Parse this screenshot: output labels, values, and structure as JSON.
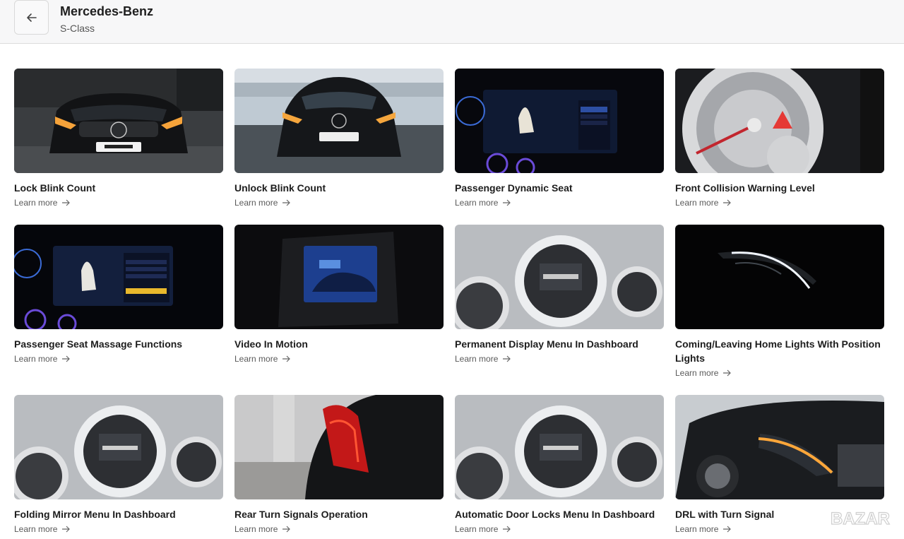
{
  "header": {
    "make": "Mercedes-Benz",
    "model": "S-Class",
    "back_icon": "arrow-left-icon"
  },
  "cards": [
    {
      "title": "Lock  Blink  Count",
      "link": "Learn more",
      "image": "car-front-night"
    },
    {
      "title": "Unlock  Blink  Count",
      "link": "Learn more",
      "image": "car-front-lake"
    },
    {
      "title": "Passenger Dynamic  Seat",
      "link": "Learn more",
      "image": "infotainment-seat"
    },
    {
      "title": "Front Collision Warning Level",
      "link": "Learn more",
      "image": "speedometer"
    },
    {
      "title": "Passenger Seat Massage Functions",
      "link": "Learn more",
      "image": "infotainment-massage"
    },
    {
      "title": "Video In Motion",
      "link": "Learn more",
      "image": "screen-video"
    },
    {
      "title": "Permanent Display Menu In Dashboard",
      "link": "Learn more",
      "image": "instrument-cluster"
    },
    {
      "title": "Coming/Leaving Home Lights With Position Lights",
      "link": "Learn more",
      "image": "headlight-dark"
    },
    {
      "title": "Folding Mirror Menu In Dashboard",
      "link": "Learn more",
      "image": "instrument-cluster"
    },
    {
      "title": "Rear Turn Signals Operation",
      "link": "Learn more",
      "image": "taillight"
    },
    {
      "title": "Automatic Door Locks Menu In Dashboard",
      "link": "Learn more",
      "image": "instrument-cluster"
    },
    {
      "title": "DRL with Turn Signal",
      "link": "Learn more",
      "image": "headlight-day"
    }
  ],
  "watermark": "BAZAR"
}
